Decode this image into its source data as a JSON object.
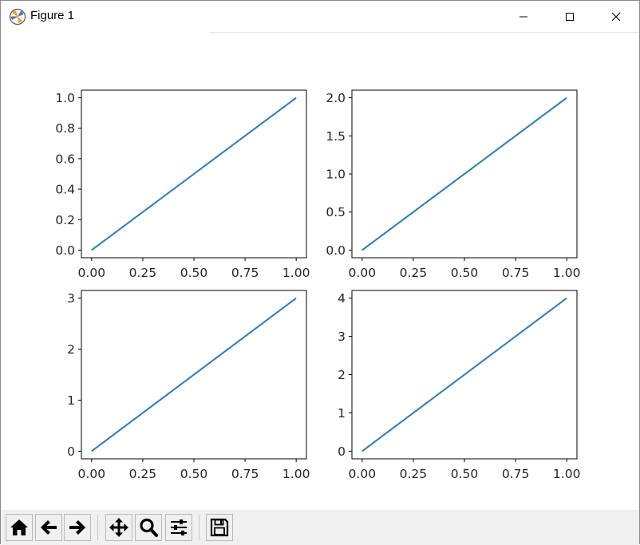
{
  "window": {
    "title": "Figure 1",
    "controls": [
      "minimize",
      "maximize",
      "close"
    ]
  },
  "toolbar": {
    "buttons": [
      {
        "name": "home-button",
        "icon": "home-icon"
      },
      {
        "name": "back-button",
        "icon": "arrow-left-icon"
      },
      {
        "name": "forward-button",
        "icon": "arrow-right-icon"
      },
      {
        "name": "pan-button",
        "icon": "move-icon"
      },
      {
        "name": "zoom-button",
        "icon": "magnifier-icon"
      },
      {
        "name": "configure-subplots-button",
        "icon": "sliders-icon"
      },
      {
        "name": "save-button",
        "icon": "floppy-disk-icon"
      }
    ]
  },
  "colors": {
    "line": "#2d7bb6",
    "axes": "#000000",
    "text": "#262626"
  },
  "chart_data": [
    {
      "type": "line",
      "title": "",
      "xlabel": "",
      "ylabel": "",
      "x": [
        0,
        1
      ],
      "y": [
        0,
        1
      ],
      "xlim": [
        -0.05,
        1.05
      ],
      "ylim": [
        -0.05,
        1.05
      ],
      "xticks": [
        "0.00",
        "0.25",
        "0.50",
        "0.75",
        "1.00"
      ],
      "yticks": [
        "0.0",
        "0.2",
        "0.4",
        "0.6",
        "0.8",
        "1.0"
      ],
      "ytick_values": [
        0,
        0.2,
        0.4,
        0.6,
        0.8,
        1.0
      ],
      "grid": false
    },
    {
      "type": "line",
      "title": "",
      "xlabel": "",
      "ylabel": "",
      "x": [
        0,
        1
      ],
      "y": [
        0,
        2
      ],
      "xlim": [
        -0.05,
        1.05
      ],
      "ylim": [
        -0.1,
        2.1
      ],
      "xticks": [
        "0.00",
        "0.25",
        "0.50",
        "0.75",
        "1.00"
      ],
      "yticks": [
        "0.0",
        "0.5",
        "1.0",
        "1.5",
        "2.0"
      ],
      "ytick_values": [
        0,
        0.5,
        1.0,
        1.5,
        2.0
      ],
      "grid": false
    },
    {
      "type": "line",
      "title": "",
      "xlabel": "",
      "ylabel": "",
      "x": [
        0,
        1
      ],
      "y": [
        0,
        3
      ],
      "xlim": [
        -0.05,
        1.05
      ],
      "ylim": [
        -0.15,
        3.15
      ],
      "xticks": [
        "0.00",
        "0.25",
        "0.50",
        "0.75",
        "1.00"
      ],
      "yticks": [
        "0",
        "1",
        "2",
        "3"
      ],
      "ytick_values": [
        0,
        1,
        2,
        3
      ],
      "grid": false
    },
    {
      "type": "line",
      "title": "",
      "xlabel": "",
      "ylabel": "",
      "x": [
        0,
        1
      ],
      "y": [
        0,
        4
      ],
      "xlim": [
        -0.05,
        1.05
      ],
      "ylim": [
        -0.2,
        4.2
      ],
      "xticks": [
        "0.00",
        "0.25",
        "0.50",
        "0.75",
        "1.00"
      ],
      "yticks": [
        "0",
        "1",
        "2",
        "3",
        "4"
      ],
      "ytick_values": [
        0,
        1,
        2,
        3,
        4
      ],
      "grid": false
    }
  ]
}
